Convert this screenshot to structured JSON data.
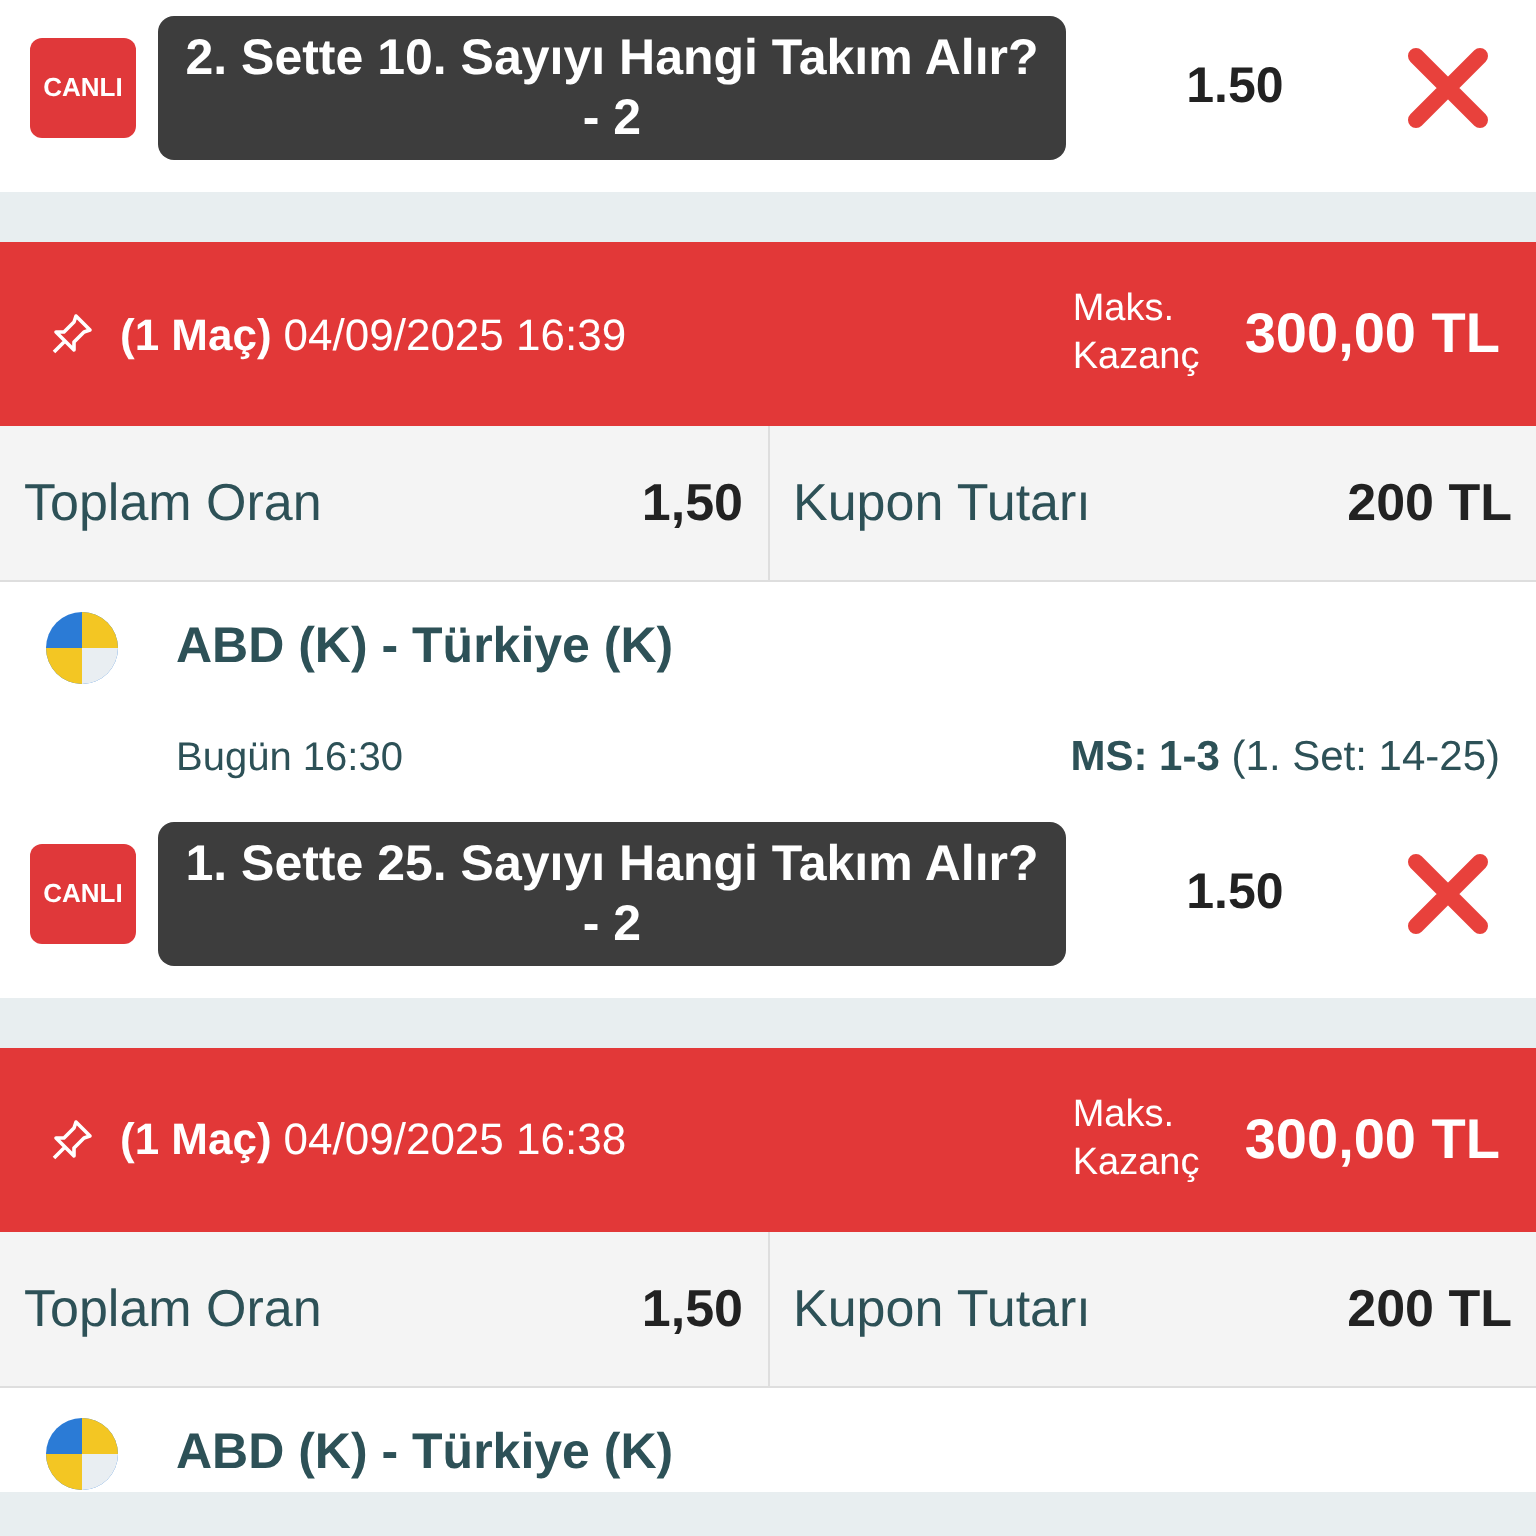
{
  "blocks": [
    {
      "bet": {
        "badge": "CANLI",
        "selection": "2. Sette 10. Sayıyı Hangi Takım Alır? - 2",
        "odds": "1.50"
      }
    },
    {
      "header": {
        "count": "(1 Maç)",
        "datetime": "04/09/2025 16:39",
        "max_label": "Maks. Kazanç",
        "max_value": "300,00 TL"
      },
      "stats": [
        {
          "label": "Toplam Oran",
          "value": "1,50"
        },
        {
          "label": "Kupon Tutarı",
          "value": "200 TL"
        }
      ],
      "match": {
        "teams": "ABD (K) - Türkiye (K)",
        "time": "Bugün 16:30",
        "score": "MS: 1-3",
        "score_detail": "(1. Set: 14-25)"
      },
      "bet": {
        "badge": "CANLI",
        "selection": "1. Sette 25. Sayıyı Hangi Takım Alır? - 2",
        "odds": "1.50"
      }
    },
    {
      "header": {
        "count": "(1 Maç)",
        "datetime": "04/09/2025 16:38",
        "max_label": "Maks. Kazanç",
        "max_value": "300,00 TL"
      },
      "stats": [
        {
          "label": "Toplam Oran",
          "value": "1,50"
        },
        {
          "label": "Kupon Tutarı",
          "value": "200 TL"
        }
      ],
      "match": {
        "teams": "ABD (K) - Türkiye (K)"
      }
    }
  ]
}
